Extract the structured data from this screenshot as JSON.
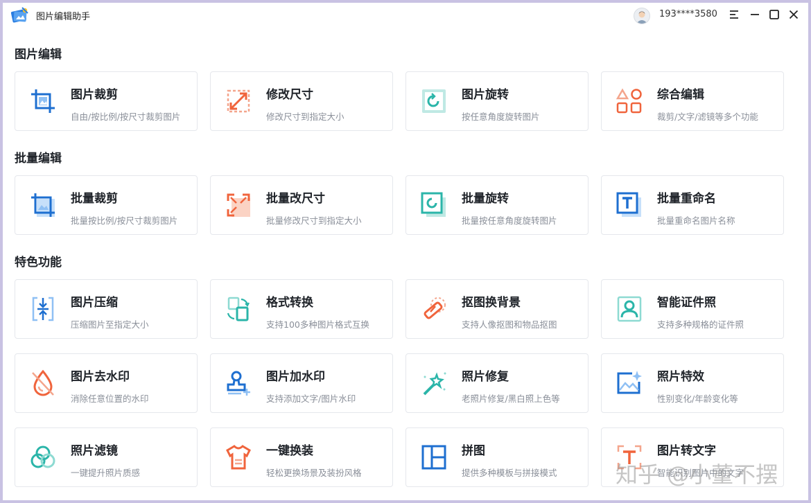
{
  "app": {
    "title": "图片编辑助手",
    "user_phone": "193****3580"
  },
  "sections": [
    {
      "title": "图片编辑",
      "cards": [
        {
          "title": "图片裁剪",
          "desc": "自由/按比例/按尺寸裁剪图片",
          "icon": "crop-icon"
        },
        {
          "title": "修改尺寸",
          "desc": "修改尺寸到指定大小",
          "icon": "resize-icon"
        },
        {
          "title": "图片旋转",
          "desc": "按任意角度旋转图片",
          "icon": "rotate-icon"
        },
        {
          "title": "综合编辑",
          "desc": "裁剪/文字/滤镜等多个功能",
          "icon": "shapes-icon"
        }
      ]
    },
    {
      "title": "批量编辑",
      "cards": [
        {
          "title": "批量裁剪",
          "desc": "批量按比例/按尺寸裁剪图片",
          "icon": "batch-crop-icon"
        },
        {
          "title": "批量改尺寸",
          "desc": "批量修改尺寸到指定大小",
          "icon": "batch-resize-icon"
        },
        {
          "title": "批量旋转",
          "desc": "批量按任意角度旋转图片",
          "icon": "batch-rotate-icon"
        },
        {
          "title": "批量重命名",
          "desc": "批量重命名图片名称",
          "icon": "rename-icon"
        }
      ]
    },
    {
      "title": "特色功能",
      "cards": [
        {
          "title": "图片压缩",
          "desc": "压缩图片至指定大小",
          "icon": "compress-icon"
        },
        {
          "title": "格式转换",
          "desc": "支持100多种图片格式互换",
          "icon": "convert-icon"
        },
        {
          "title": "抠图换背景",
          "desc": "支持人像抠图和物品抠图",
          "icon": "eraser-icon"
        },
        {
          "title": "智能证件照",
          "desc": "支持多种规格的证件照",
          "icon": "id-photo-icon"
        },
        {
          "title": "图片去水印",
          "desc": "消除任意位置的水印",
          "icon": "remove-watermark-icon"
        },
        {
          "title": "图片加水印",
          "desc": "支持添加文字/图片水印",
          "icon": "add-watermark-icon"
        },
        {
          "title": "照片修复",
          "desc": "老照片修复/黑白照上色等",
          "icon": "magic-wand-icon"
        },
        {
          "title": "照片特效",
          "desc": "性别变化/年龄变化等",
          "icon": "effect-icon"
        },
        {
          "title": "照片滤镜",
          "desc": "一键提升照片质感",
          "icon": "filter-icon"
        },
        {
          "title": "一键换装",
          "desc": "轻松更换场景及装扮风格",
          "icon": "tshirt-icon"
        },
        {
          "title": "拼图",
          "desc": "提供多种模板与拼接模式",
          "icon": "collage-icon"
        },
        {
          "title": "图片转文字",
          "desc": "智能识别图片中的文字",
          "icon": "ocr-icon"
        }
      ]
    }
  ],
  "watermark": "知乎 @小董不摆",
  "colors": {
    "blue": "#1e6fd0",
    "orange": "#f0643c",
    "teal": "#2bb5a9"
  }
}
